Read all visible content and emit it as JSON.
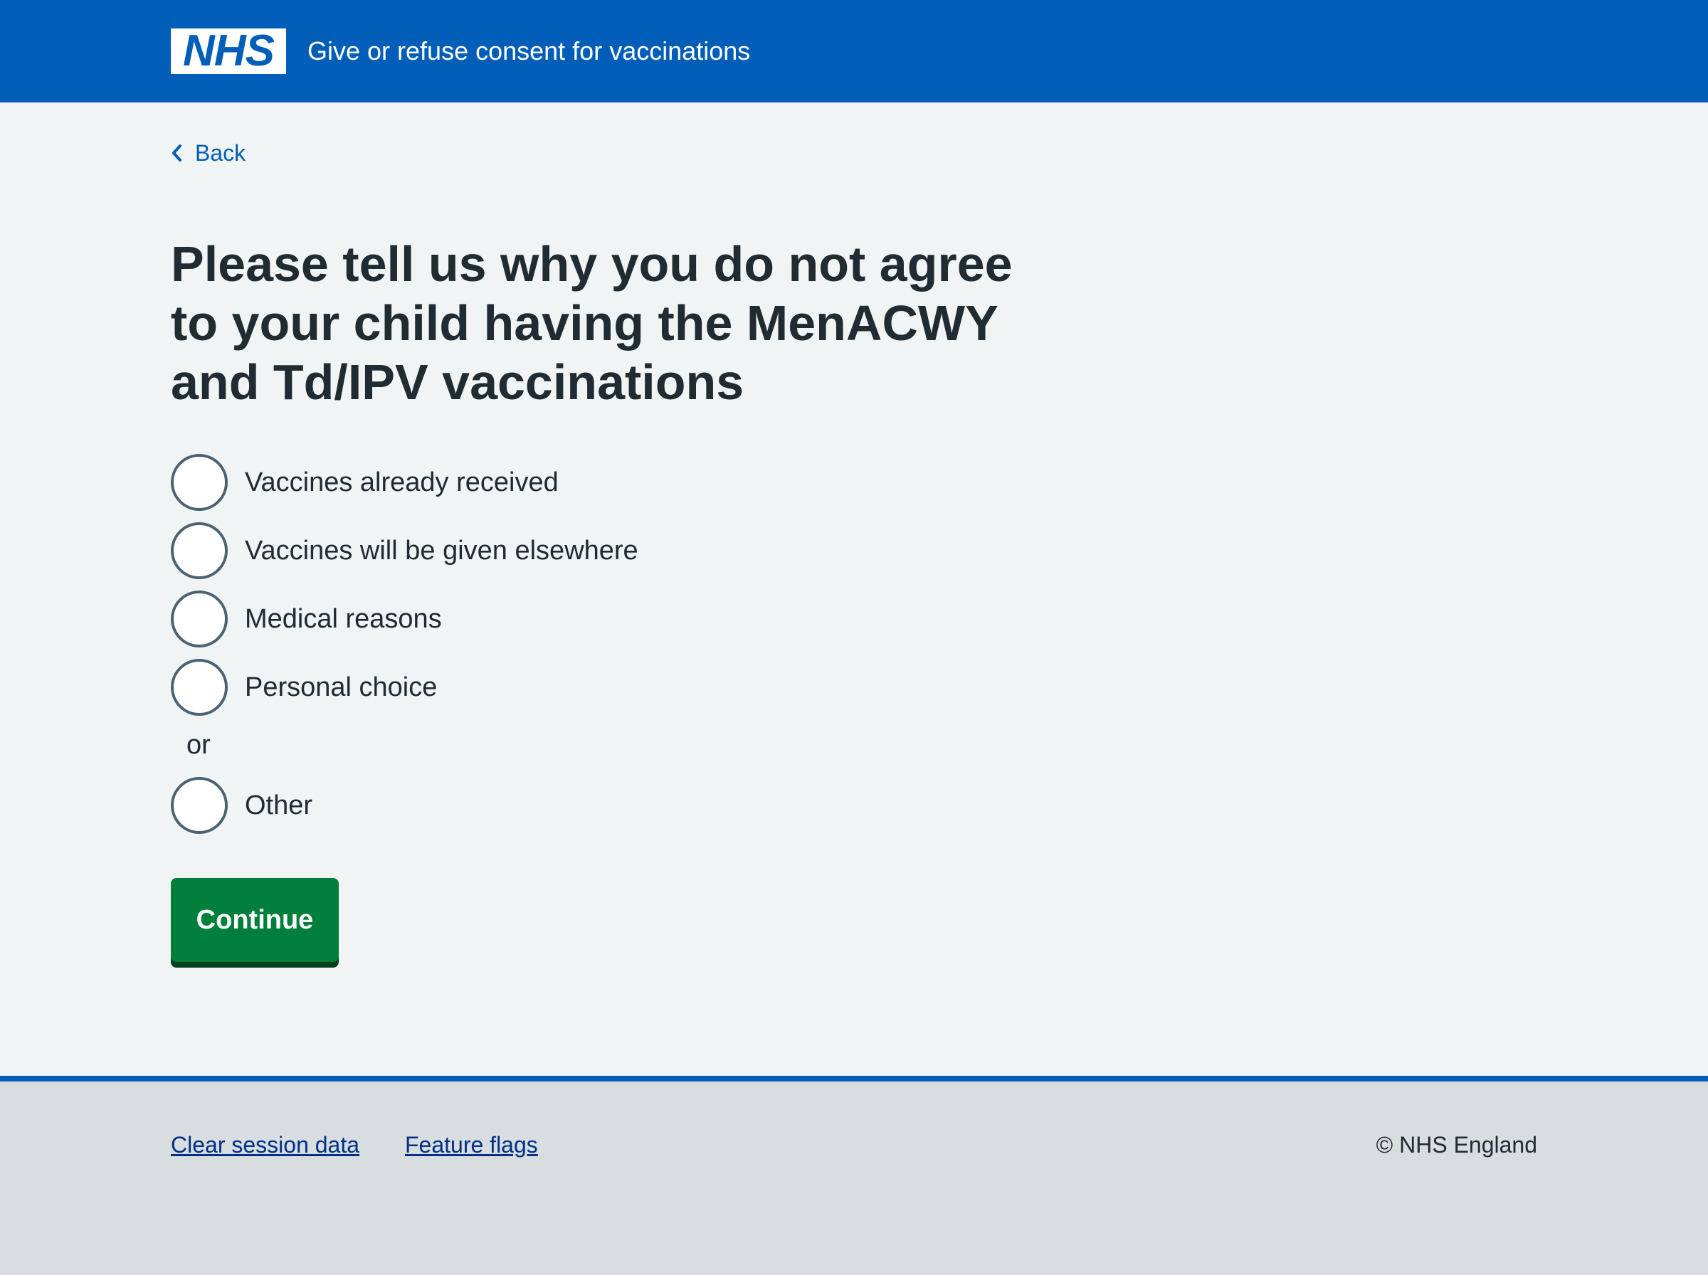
{
  "header": {
    "logo_text": "NHS",
    "service_name": "Give or refuse consent for vaccinations"
  },
  "back_link": {
    "label": "Back",
    "icon": "chevron-left-icon"
  },
  "page": {
    "heading": "Please tell us why you do not agree to your child having the MenACWY and Td/IPV vaccinations",
    "options": [
      {
        "label": "Vaccines already received",
        "checked": false
      },
      {
        "label": "Vaccines will be given elsewhere",
        "checked": false
      },
      {
        "label": "Medical reasons",
        "checked": false
      },
      {
        "label": "Personal choice",
        "checked": false
      }
    ],
    "divider": "or",
    "other_option": {
      "label": "Other",
      "checked": false
    },
    "continue_label": "Continue"
  },
  "footer": {
    "links": [
      "Clear session data",
      "Feature flags"
    ],
    "copyright": "© NHS England"
  },
  "colors": {
    "header_blue": "#005eb8",
    "button_green": "#007f3b",
    "page_bg": "#f0f4f5",
    "footer_bg": "#d8dde0",
    "text": "#212b32"
  }
}
